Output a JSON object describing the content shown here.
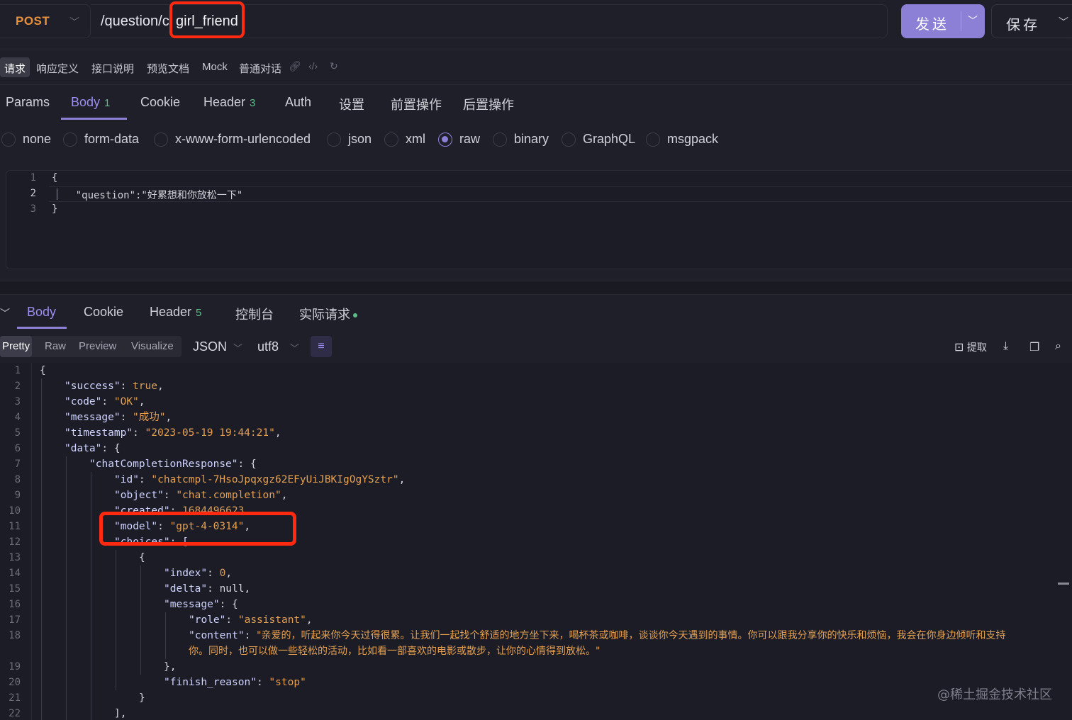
{
  "request": {
    "method": "POST",
    "url_prefix": "/question/c",
    "url_highlight": "girl_friend",
    "send_label": "发送",
    "save_label": "保存"
  },
  "subtabs": [
    "请求",
    "响应定义",
    "接口说明",
    "预览文档",
    "Mock",
    "普通对话"
  ],
  "main_tabs": {
    "params": "Params",
    "body": "Body",
    "body_count": "1",
    "cookie": "Cookie",
    "header": "Header",
    "header_count": "3",
    "auth": "Auth",
    "settings": "设置",
    "pre": "前置操作",
    "post": "后置操作"
  },
  "body_types": [
    "none",
    "form-data",
    "x-www-form-urlencoded",
    "json",
    "xml",
    "raw",
    "binary",
    "GraphQL",
    "msgpack"
  ],
  "body_type_selected": "raw",
  "request_body": [
    {
      "n": "1",
      "code": "{"
    },
    {
      "n": "2",
      "code": "    \"question\":\"好累想和你放松一下\""
    },
    {
      "n": "3",
      "code": "}"
    }
  ],
  "response_tabs": {
    "body": "Body",
    "cookie": "Cookie",
    "header": "Header",
    "header_count": "5",
    "console": "控制台",
    "actual": "实际请求"
  },
  "response_toolbar": {
    "views": [
      "Pretty",
      "Raw",
      "Preview",
      "Visualize"
    ],
    "format": "JSON",
    "encoding": "utf8",
    "extract_label": "提取"
  },
  "response_lines": {
    "n1": "1",
    "n2": "2",
    "n3": "3",
    "n4": "4",
    "n5": "5",
    "n6": "6",
    "n7": "7",
    "n8": "8",
    "n9": "9",
    "n10": "10",
    "n11": "11",
    "n12": "12",
    "n13": "13",
    "n14": "14",
    "n15": "15",
    "n16": "16",
    "n17": "17",
    "n18": "18",
    "n19": "19",
    "n20": "20",
    "n21": "21",
    "n22": "22",
    "success_key": "\"success\"",
    "success_val": "true",
    "code_key": "\"code\"",
    "code_val": "\"OK\"",
    "message_key": "\"message\"",
    "message_val": "\"成功\"",
    "timestamp_key": "\"timestamp\"",
    "timestamp_val": "\"2023-05-19 19:44:21\"",
    "data_key": "\"data\"",
    "ccr_key": "\"chatCompletionResponse\"",
    "id_key": "\"id\"",
    "id_val": "\"chatcmpl-7HsoJpqxgz62EFyUiJBKIgOgYSztr\"",
    "object_key": "\"object\"",
    "object_val": "\"chat.completion\"",
    "created_key": "\"created\"",
    "created_val": "1684496623",
    "model_key": "\"model\"",
    "model_val": "\"gpt-4-0314\"",
    "choices_partial": "\"choices\": [",
    "index_key": "\"index\"",
    "index_val": "0",
    "delta_key": "\"delta\"",
    "delta_val": "null",
    "msg_key": "\"message\"",
    "role_key": "\"role\"",
    "role_val": "\"assistant\"",
    "content_key": "\"content\"",
    "content_val_1": "\"亲爱的，听起来你今天过得很累。让我们一起找个舒适的地方坐下来，喝杯茶或咖啡，谈谈你今天遇到的事情。你可以跟我分享你的快乐和烦恼，我会在你身边倾听和支持",
    "content_val_2": "你。同时，也可以做一些轻松的活动，比如看一部喜欢的电影或散步，让你的心情得到放松。\"",
    "finish_key": "\"finish_reason\"",
    "finish_val": "\"stop\""
  },
  "watermark": "@稀土掘金技术社区",
  "colors": {
    "accent": "#8b7fd6",
    "highlight_box": "#ff2a10",
    "method": "#e8903a",
    "string": "#e5a04f"
  }
}
